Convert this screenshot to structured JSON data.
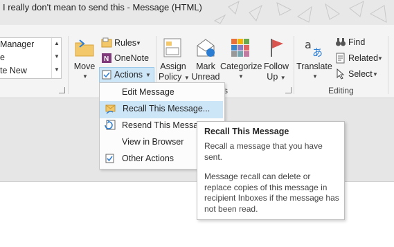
{
  "window": {
    "title": "I really don't mean to send this  - Message (HTML)"
  },
  "gallery": {
    "items": [
      "Manager",
      "e",
      "te New"
    ]
  },
  "move": {
    "move_label": "Move",
    "rules_label": "Rules",
    "onenote_label": "OneNote",
    "actions_label": "Actions"
  },
  "tags": {
    "assign_policy": [
      "Assign",
      "Policy"
    ],
    "mark_unread": [
      "Mark",
      "Unread"
    ],
    "categorize": "Categorize",
    "follow_up": [
      "Follow",
      "Up"
    ],
    "group_label": "s"
  },
  "editing": {
    "translate": "Translate",
    "find": "Find",
    "related": "Related",
    "select": "Select",
    "group_label": "Editing"
  },
  "actions_menu": {
    "items": [
      {
        "label": "Edit Message",
        "icon": "none"
      },
      {
        "label": "Recall This Message...",
        "icon": "recall-icon"
      },
      {
        "label": "Resend This Message",
        "icon": "resend-icon"
      },
      {
        "label": "View in Browser",
        "icon": "none"
      },
      {
        "label": "Other Actions",
        "icon": "other-actions-icon"
      }
    ],
    "highlighted_index": 1
  },
  "tooltip": {
    "title": "Recall This Message",
    "para1": "Recall a message that you have sent.",
    "para2": "Message recall can delete or replace copies of this message in recipient Inboxes if the message has not been read."
  },
  "colors": {
    "accent_highlight": "#cde6f7",
    "flag_red": "#d9534f",
    "onenote_purple": "#80397b"
  }
}
